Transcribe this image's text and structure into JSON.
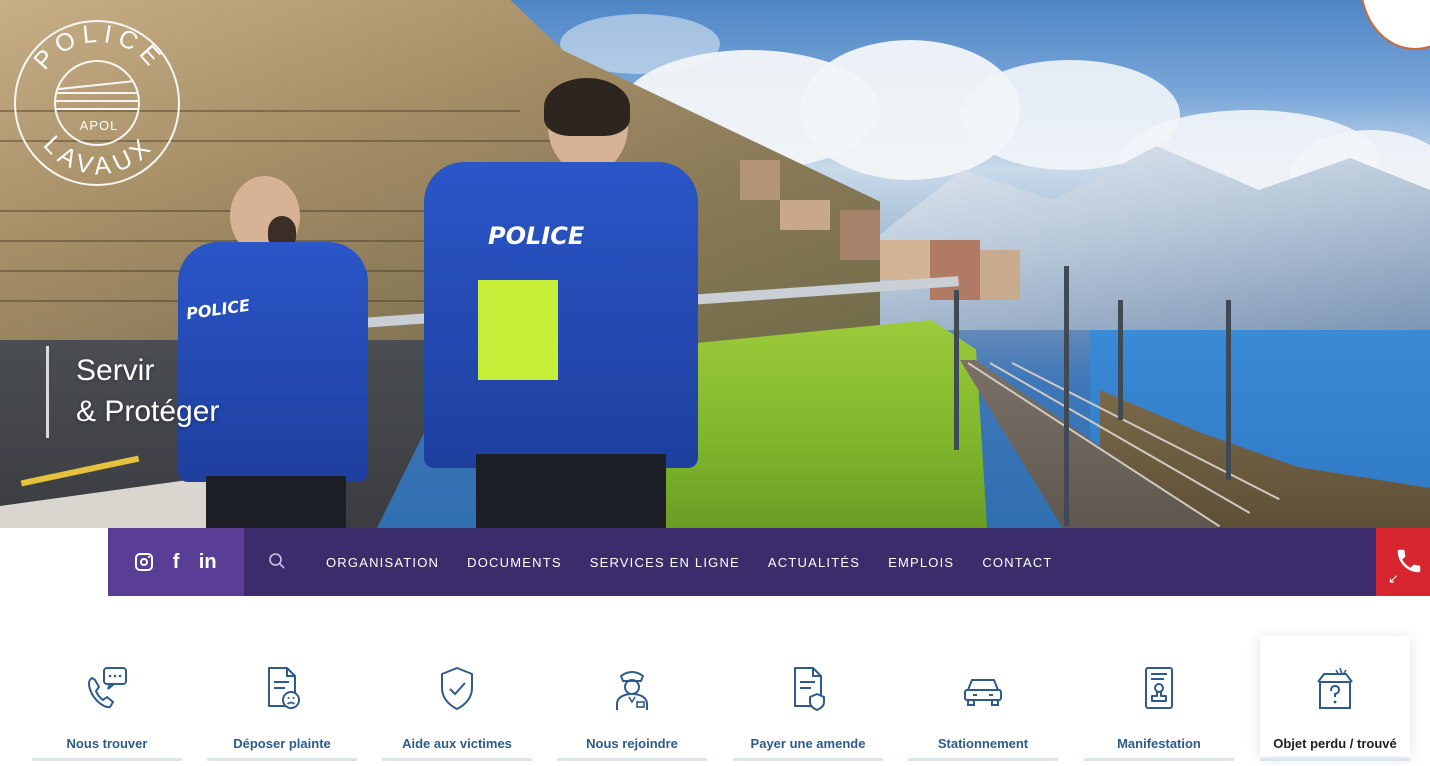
{
  "logo": {
    "text_top": "POLICE",
    "text_bottom": "LAVAUX",
    "center": "APOL"
  },
  "hero": {
    "slogan_line1": "Servir",
    "slogan_line2": "& Protéger",
    "officer_back_label": "POLICE",
    "officer_side_label": "POLICE"
  },
  "social": {
    "instagram": "instagram-icon",
    "facebook": "f",
    "linkedin": "in"
  },
  "nav": {
    "items": [
      "ORGANISATION",
      "DOCUMENTS",
      "SERVICES EN LIGNE",
      "ACTUALITÉS",
      "EMPLOIS",
      "CONTACT"
    ],
    "phone_arrow": "↙"
  },
  "quick_links": [
    {
      "label": "Nous trouver",
      "icon": "phone-chat-icon"
    },
    {
      "label": "Déposer plainte",
      "icon": "complaint-document-icon"
    },
    {
      "label": "Aide aux victimes",
      "icon": "shield-check-icon"
    },
    {
      "label": "Nous rejoindre",
      "icon": "police-officer-icon"
    },
    {
      "label": "Payer une amende",
      "icon": "document-shield-icon"
    },
    {
      "label": "Stationnement",
      "icon": "car-icon"
    },
    {
      "label": "Manifestation",
      "icon": "stamp-document-icon"
    },
    {
      "label": "Objet perdu / trouvé",
      "icon": "lost-box-icon"
    }
  ],
  "colors": {
    "nav_bg": "#3b2d6b",
    "social_bg": "#5a3e96",
    "phone_bg": "#d7262f",
    "link_blue": "#2d5b8e",
    "icon_blue": "#2d5b8e"
  }
}
